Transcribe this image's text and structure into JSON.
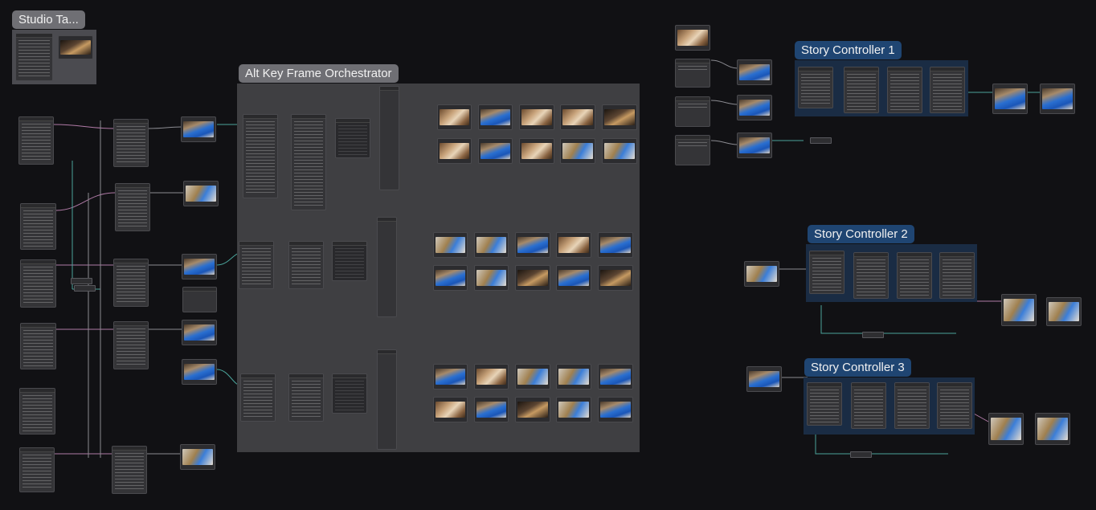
{
  "groups": {
    "studio": {
      "title": "Studio Ta...",
      "color": "#6f6f74",
      "body": "#4b4b50"
    },
    "alt": {
      "title": "Alt Key Frame Orchestrator",
      "color": "#6f6f74",
      "body": "#3f3f42"
    },
    "story1": {
      "title": "Story Controller 1",
      "color": "#1f4572",
      "body": "#1a2c44"
    },
    "story2": {
      "title": "Story Controller 2",
      "color": "#1f4572",
      "body": "#1a2c44"
    },
    "story3": {
      "title": "Story Controller 3",
      "color": "#1f4572",
      "body": "#1a2c44"
    }
  },
  "colors": {
    "canvas": "#111114",
    "wire_teal": "#4aa39a",
    "wire_grey": "#8b8b91",
    "wire_pink": "#b07aa6"
  }
}
